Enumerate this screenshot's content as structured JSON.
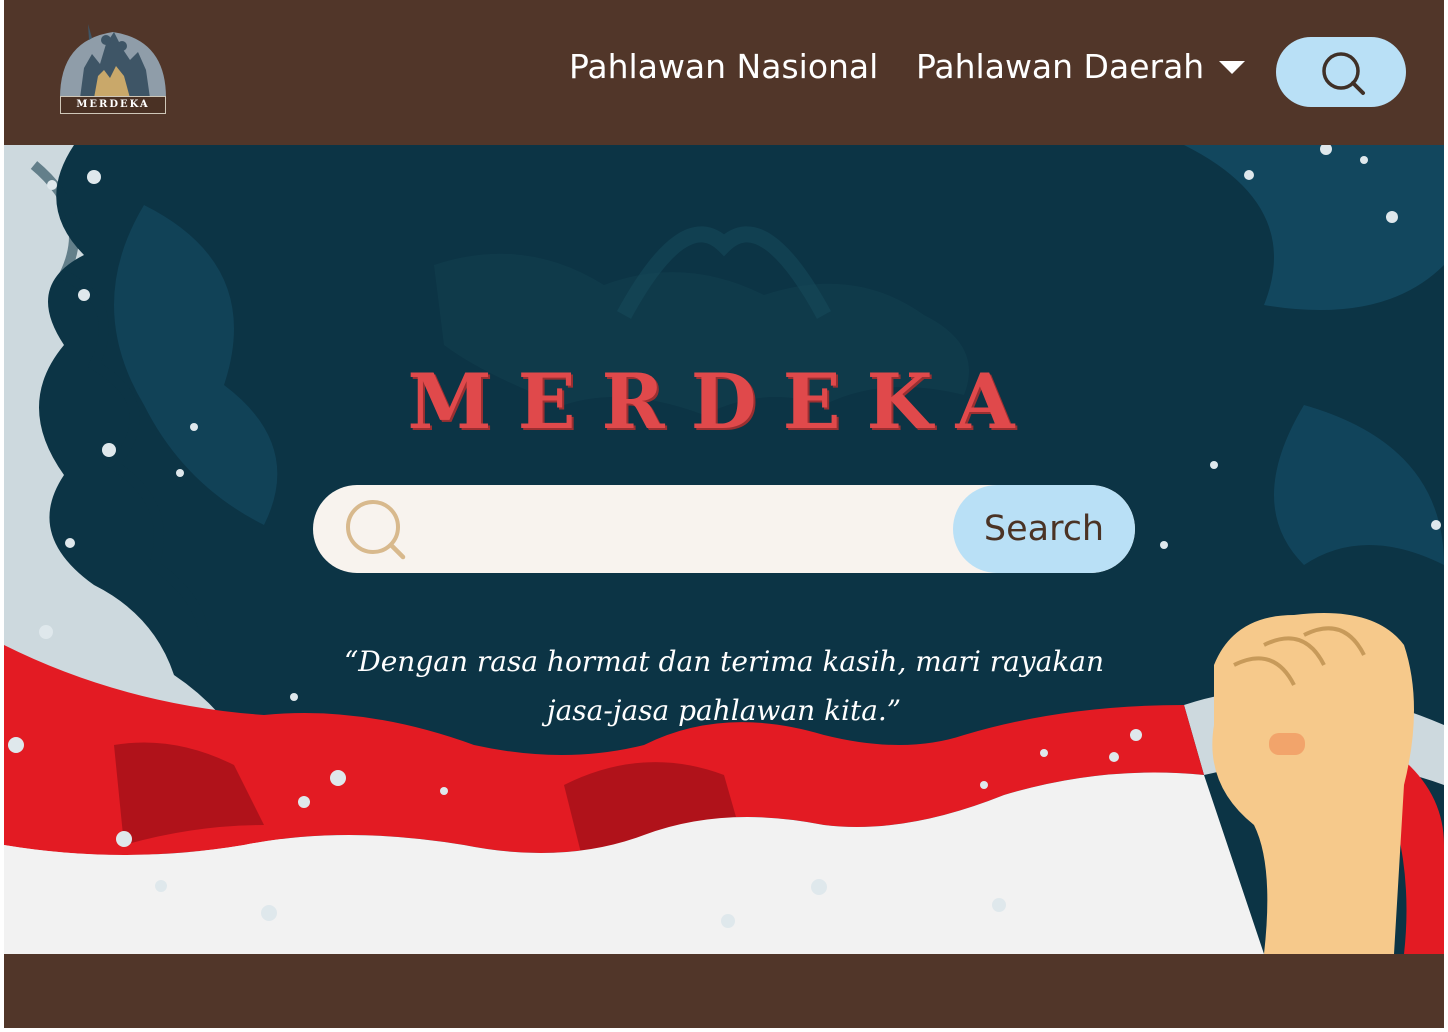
{
  "header": {
    "logo_text": "MERDEKA",
    "nav": {
      "nasional": "Pahlawan Nasional",
      "daerah": "Pahlawan Daerah"
    }
  },
  "hero": {
    "title": "MERDEKA",
    "search": {
      "placeholder": "",
      "button_label": "Search"
    },
    "quote": "“Dengan rasa hormat dan terima kasih, mari rayakan jasa-jasa pahlawan kita.”"
  },
  "icons": {
    "header_search": "search-icon",
    "hero_search": "search-icon",
    "dropdown": "caret-down-icon"
  },
  "colors": {
    "brown": "#513629",
    "light_blue": "#b9e0f6",
    "title_red": "#e0494b",
    "search_field": "#f8f3ee",
    "navy": "#0c3445"
  }
}
